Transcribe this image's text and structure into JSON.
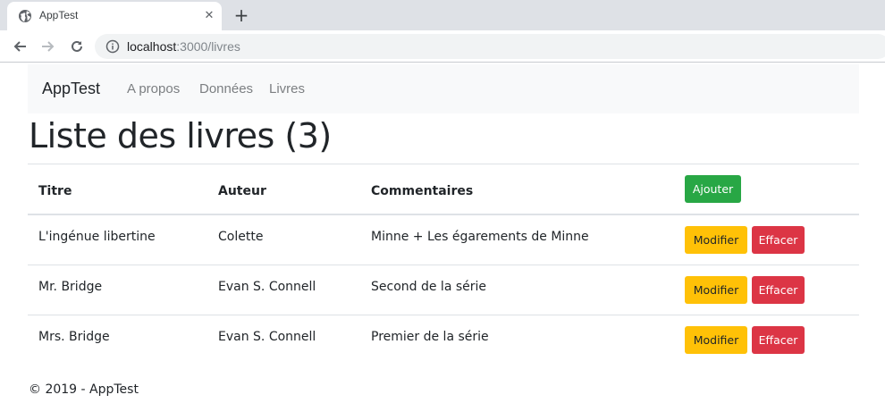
{
  "browser": {
    "tab_title": "AppTest",
    "tab_close": "✕",
    "new_tab": "+",
    "url_host": "localhost",
    "url_rest": ":3000/livres"
  },
  "navbar": {
    "brand": "AppTest",
    "links": [
      "A propos",
      "Données",
      "Livres"
    ]
  },
  "page": {
    "title": "Liste des livres (3)"
  },
  "table": {
    "headers": [
      "Titre",
      "Auteur",
      "Commentaires"
    ],
    "add_label": "Ajouter",
    "edit_label": "Modifier",
    "delete_label": "Effacer",
    "rows": [
      {
        "titre": "L'ingénue libertine",
        "auteur": "Colette",
        "commentaires": "Minne + Les égarements de Minne"
      },
      {
        "titre": "Mr. Bridge",
        "auteur": "Evan S. Connell",
        "commentaires": "Second de la série"
      },
      {
        "titre": "Mrs. Bridge",
        "auteur": "Evan S. Connell",
        "commentaires": "Premier de la série"
      }
    ]
  },
  "footer": {
    "text": "© 2019 - AppTest"
  },
  "colors": {
    "add": "#28a745",
    "edit": "#ffc107",
    "delete": "#dc3545"
  }
}
